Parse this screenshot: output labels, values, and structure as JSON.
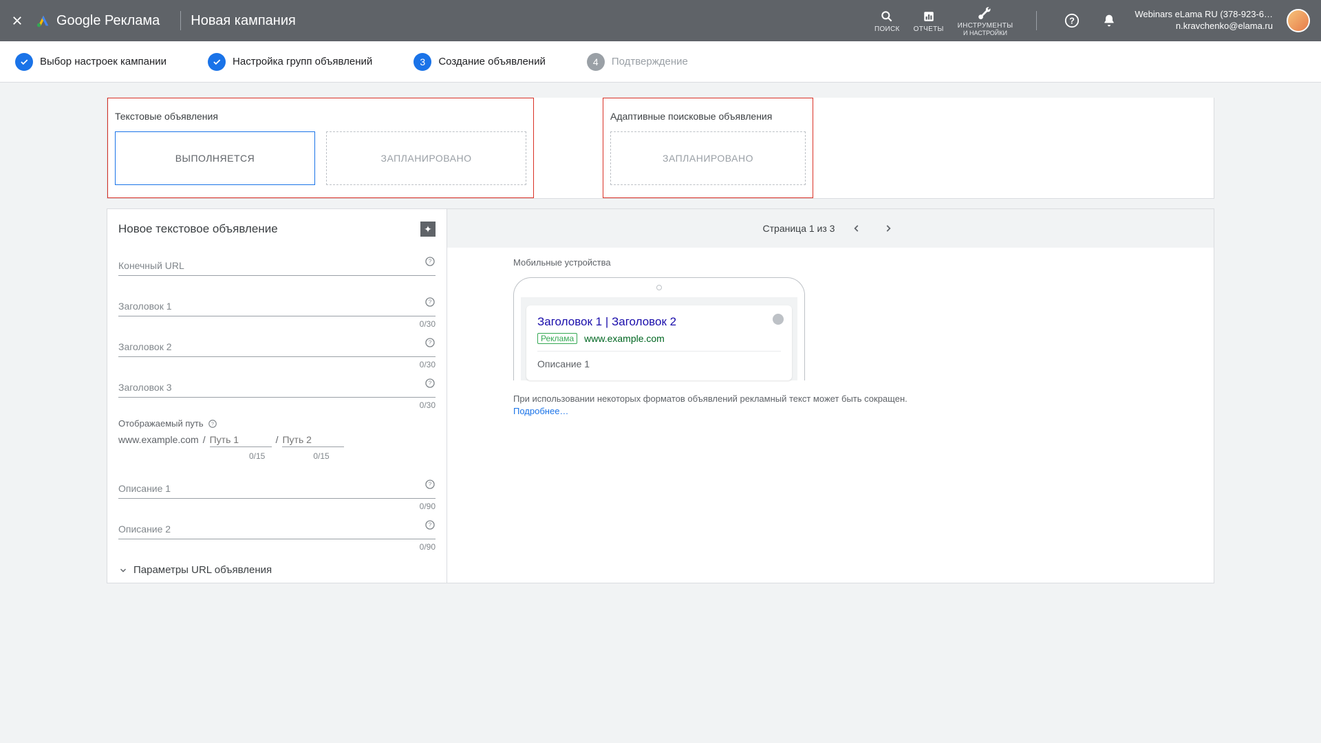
{
  "header": {
    "product": "Google Реклама",
    "page_title": "Новая кампания",
    "tools": {
      "search": "ПОИСК",
      "reports": "ОТЧЕТЫ",
      "tools_line1": "ИНСТРУМЕНТЫ",
      "tools_line2": "И НАСТРОЙКИ"
    },
    "account": {
      "line1": "Webinars eLama RU (378-923-6…",
      "line2": "n.kravchenko@elama.ru"
    }
  },
  "steps": {
    "s1": "Выбор настроек кампании",
    "s2": "Настройка групп объявлений",
    "s3_num": "3",
    "s3": "Создание объявлений",
    "s4_num": "4",
    "s4": "Подтверждение"
  },
  "boxes": {
    "text_ads_title": "Текстовые объявления",
    "responsive_title": "Адаптивные поисковые объявления",
    "chip_running": "ВЫПОЛНЯЕТСЯ",
    "chip_planned": "ЗАПЛАНИРОВАНО"
  },
  "form": {
    "title": "Новое текстовое объявление",
    "final_url": "Конечный URL",
    "headline1": "Заголовок 1",
    "headline2": "Заголовок 2",
    "headline3": "Заголовок 3",
    "counter30": "0/30",
    "display_path_label": "Отображаемый путь",
    "display_base": "www.example.com",
    "path1": "Путь 1",
    "path2": "Путь 2",
    "counter15": "0/15",
    "desc1": "Описание 1",
    "desc2": "Описание 2",
    "counter90": "0/90",
    "url_params": "Параметры URL объявления"
  },
  "preview": {
    "pager": "Страница 1 из 3",
    "caption": "Мобильные устройства",
    "ad_head": "Заголовок 1 | Заголовок 2",
    "ad_badge": "Реклама",
    "ad_url": "www.example.com",
    "ad_desc": "Описание 1",
    "note": "При использовании некоторых форматов объявлений рекламный текст может быть сокращен.",
    "learn_more": "Подробнее…"
  }
}
